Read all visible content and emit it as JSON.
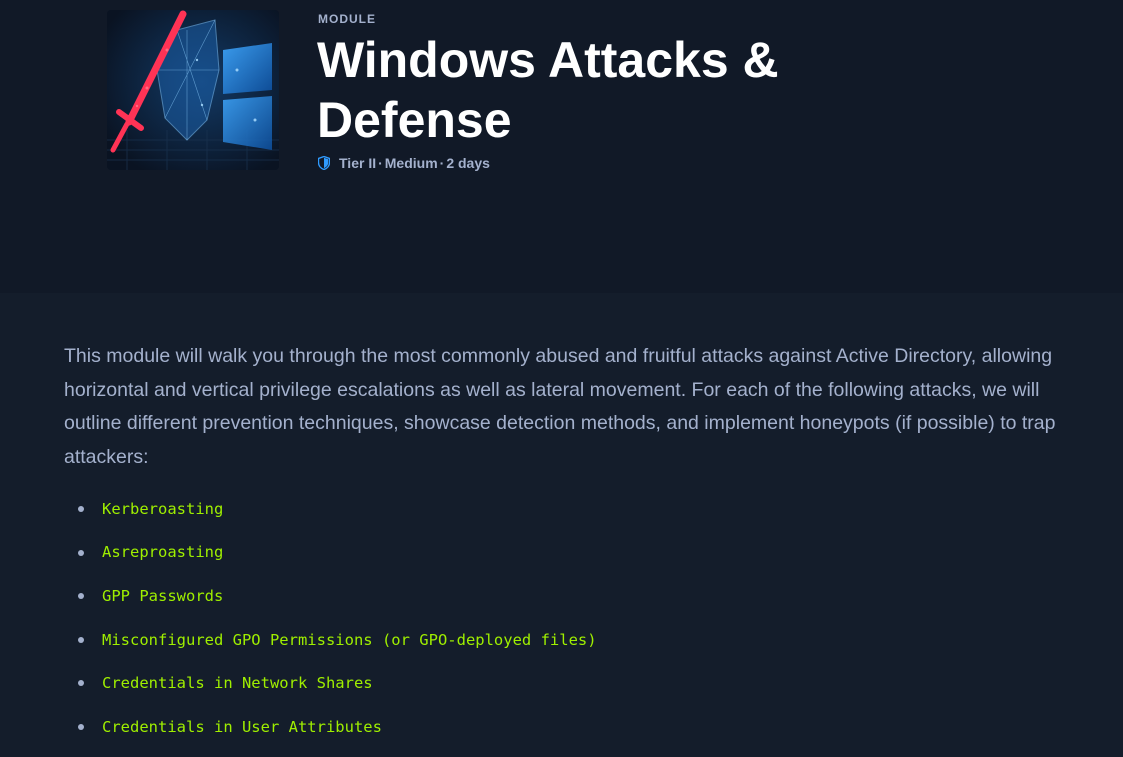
{
  "module": {
    "eyebrow": "MODULE",
    "title": "Windows Attacks & Defense",
    "meta": {
      "icon": "shield-icon",
      "tier": "Tier II",
      "difficulty": "Medium",
      "duration": "2 days",
      "separator": "·"
    },
    "description": "This module will walk you through the most commonly abused and fruitful attacks against Active Directory, allowing horizontal and vertical privilege escalations as well as lateral movement. For each of the following attacks, we will outline different prevention techniques, showcase detection methods, and implement honeypots (if possible) to trap attackers:",
    "attacks": [
      "Kerberoasting",
      "Asreproasting",
      "GPP Passwords",
      "Misconfigured GPO Permissions (or GPO-deployed files)",
      "Credentials in Network Shares",
      "Credentials in User Attributes"
    ]
  },
  "colors": {
    "hero_background": "#111927",
    "page_background": "#141d2b",
    "title": "#ffffff",
    "muted_text": "#a4b1cd",
    "code_accent": "#9fef00",
    "shield_accent": "#2f9bff"
  }
}
